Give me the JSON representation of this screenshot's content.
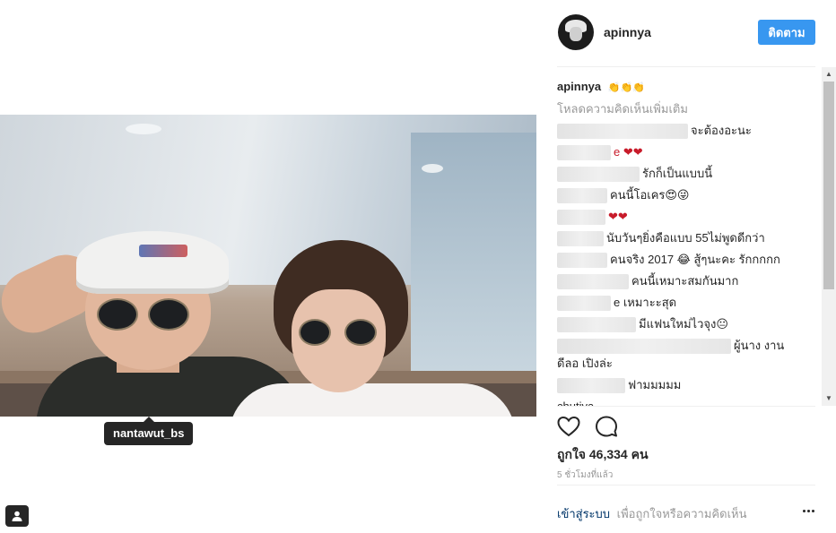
{
  "post": {
    "tag_username": "nantawut_bs"
  },
  "header": {
    "username": "apinnya",
    "follow_label": "ติดตาม"
  },
  "caption": {
    "username": "apinnya",
    "emoji": "👏👏👏"
  },
  "comments_section": {
    "load_more_label": "โหลดความคิดเห็นเพิ่มเติม",
    "comments": [
      {
        "text": "จะต้องอะนะ"
      },
      {
        "text": "e ❤❤"
      },
      {
        "text": "รักก็เป็นแบบนี้"
      },
      {
        "text": "คนนี้โอเคร😍😜"
      },
      {
        "text": "❤❤"
      },
      {
        "text": "นับวันๆยิ่งคือแบบ 55ไม่พูดดีกว่า"
      },
      {
        "text": "คนจริง 2017 😂 สู้ๆนะคะ รักกกกก"
      },
      {
        "text": "คนนี้เหมาะสมกันมาก"
      },
      {
        "text": "e เหมาะะสุด"
      },
      {
        "text": "มีแฟนใหม่ไวจุง😐"
      },
      {
        "text": "ผู้นาง งาน"
      },
      {
        "text": "ดีลอ เปิงล่ะ"
      },
      {
        "text": "ฟามมมมม"
      },
      {
        "text": "chutiva ..."
      }
    ]
  },
  "actions": {
    "likes_text": "ถูกใจ 46,334 คน",
    "timestamp": "5 ชั่วโมงที่แล้ว"
  },
  "footer": {
    "login_link": "เข้าสู่ระบบ",
    "login_text": "เพื่อถูกใจหรือความคิดเห็น"
  },
  "colors": {
    "follow_button": "#3897f0",
    "text_primary": "#262626",
    "text_secondary": "#999999",
    "link": "#003569",
    "heart_red": "#c81b2a"
  }
}
